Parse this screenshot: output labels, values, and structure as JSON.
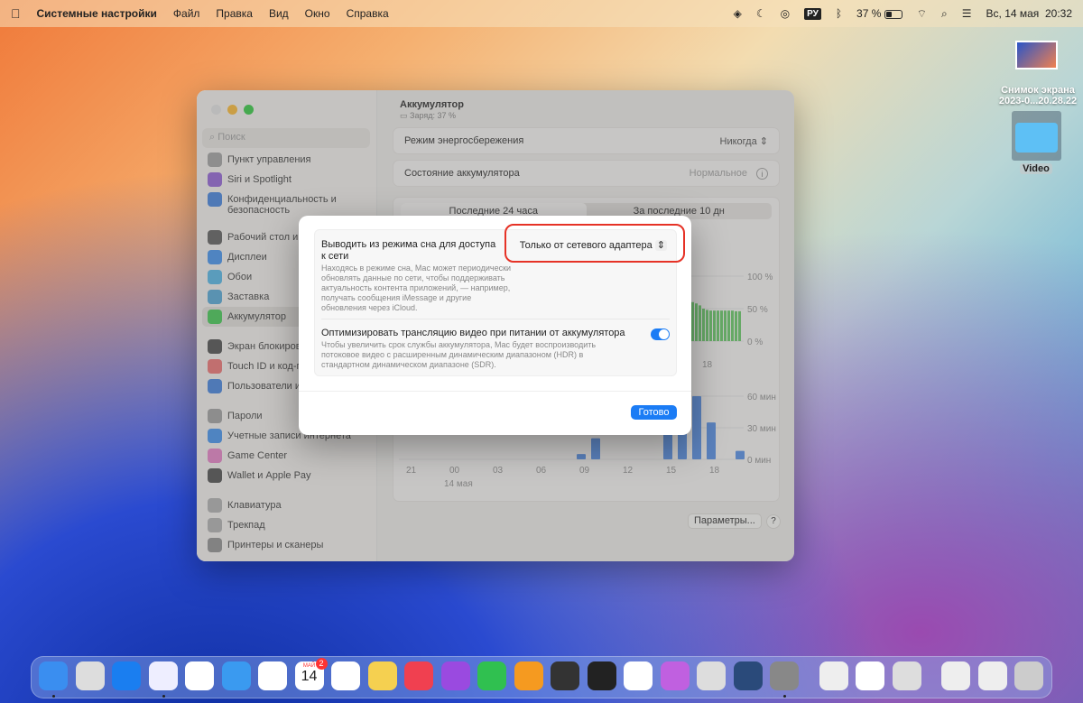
{
  "menubar": {
    "apple": "",
    "app": "Системные настройки",
    "menus": [
      "Файл",
      "Правка",
      "Вид",
      "Окно",
      "Справка"
    ],
    "input_source": "РУ",
    "battery": "37 %",
    "date": "Вс, 14 мая",
    "time": "20:32"
  },
  "desktop": {
    "screenshot_label_1": "Снимок экрана",
    "screenshot_label_2": "2023-0...20.28.22",
    "folder_label": "Video"
  },
  "sidebar": {
    "search_placeholder": "Поиск",
    "items": [
      "Пункт управления",
      "Siri и Spotlight",
      "Конфиденциальность и",
      "безопасность",
      "Рабочий стол и Dock",
      "Дисплеи",
      "Обои",
      "Заставка",
      "Аккумулятор",
      "Экран блокировки",
      "Touch ID и код-пароль",
      "Пользователи и группы",
      "Пароли",
      "Учетные записи интернета",
      "Game Center",
      "Wallet и Apple Pay",
      "Клавиатура",
      "Трекпад",
      "Принтеры и сканеры"
    ],
    "selected": "Аккумулятор"
  },
  "main": {
    "title": "Аккумулятор",
    "subtitle": "Заряд: 37 %",
    "low_power_label": "Режим энергосбережения",
    "low_power_value": "Никогда",
    "health_label": "Состояние аккумулятора",
    "health_value": "Нормальное",
    "tabs": [
      "Последние 24 часа",
      "За последние 10 дн"
    ],
    "options_button": "Параметры...",
    "help_button": "?"
  },
  "chart_data": [
    {
      "type": "bar",
      "ylim": [
        0,
        100
      ],
      "y_ticks": [
        "100 %",
        "50 %",
        "0 %"
      ],
      "x_ticks_visible": [
        "18"
      ],
      "values_visible": [
        60,
        58,
        55,
        50,
        48,
        47,
        47,
        47,
        47,
        47,
        47,
        47,
        46,
        46
      ],
      "color": "#5cc45c"
    },
    {
      "type": "bar",
      "ylim": [
        0,
        60
      ],
      "y_ticks": [
        "60 мин",
        "30 мин",
        "0 мин"
      ],
      "x_ticks": [
        "21",
        "00",
        "03",
        "06",
        "09",
        "12",
        "15",
        "18"
      ],
      "x_sublabel": "14 мая",
      "categories": [
        "09",
        "10",
        "15",
        "16",
        "17",
        "18",
        "20"
      ],
      "values": [
        5,
        20,
        45,
        50,
        60,
        35,
        8
      ],
      "color": "#4a86e0"
    }
  ],
  "modal": {
    "wake_title": "Выводить из режима сна для доступа к сети",
    "wake_desc": "Находясь в режиме сна, Mac может периодически обновлять данные по сети, чтобы поддерживать актуальность контента приложений, — например, получать сообщения iMessage и другие обновления через iCloud.",
    "wake_value": "Только от сетевого адаптера",
    "video_title": "Оптимизировать трансляцию видео при питании от аккумулятора",
    "video_desc": "Чтобы увеличить срок службы аккумулятора, Mac будет воспроизводить потоковое видео с расширенным динамическим диапазоном (HDR) в стандартном динамическом диапазоне (SDR).",
    "video_toggle_on": true,
    "done_button": "Готово"
  },
  "dock": {
    "apps": [
      "finder",
      "launchpad",
      "app-store",
      "safari",
      "chrome",
      "mail",
      "photos",
      "calendar",
      "reminders",
      "notes",
      "music",
      "podcasts",
      "numbers",
      "pages",
      "final-cut-pro",
      "compressor",
      "telegram",
      "affinity-designer",
      "pixelmator",
      "screen-app",
      "system-settings",
      "fan-control",
      "yandex",
      "preview",
      "music-file",
      "screenshot-file",
      "trash"
    ],
    "calendar_month": "МАЙ",
    "calendar_day": "14",
    "calendar_badge": "2"
  },
  "colors": {
    "accent": "#1b7cf5",
    "highlight": "#e63226"
  }
}
